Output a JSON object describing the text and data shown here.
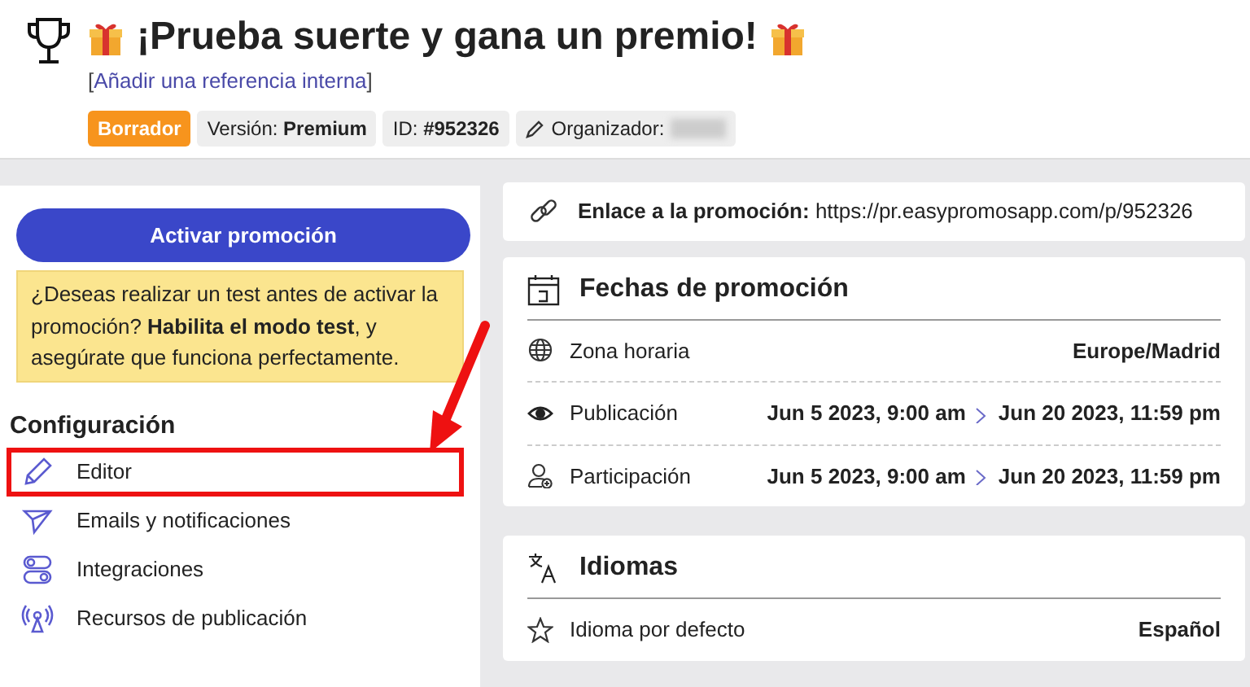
{
  "header": {
    "title": "¡Prueba suerte y gana un premio!",
    "reference_open": "[",
    "reference_link": "Añadir una referencia interna",
    "reference_close": "]",
    "badges": [
      {
        "kind": "status",
        "text": "Borrador"
      },
      {
        "kind": "field",
        "label": "Versión:",
        "value": "Premium"
      },
      {
        "kind": "field",
        "label": "ID:",
        "value": "#952326"
      },
      {
        "kind": "organizer",
        "label": "Organizador:"
      }
    ]
  },
  "sidebar": {
    "activate_button": "Activar promoción",
    "notice": {
      "before": "¿Deseas realizar un test antes de activar la promoción?",
      "link": "Habilita el modo test",
      "after": ", y asegúrate que funciona perfectamente."
    },
    "section_title": "Configuración",
    "items": [
      {
        "kind": "pencil",
        "label": "Editor",
        "highlighted": true
      },
      {
        "kind": "send",
        "label": "Emails y notificaciones",
        "highlighted": false
      },
      {
        "kind": "toggles",
        "label": "Integraciones",
        "highlighted": false
      },
      {
        "kind": "antenna",
        "label": "Recursos de publicación",
        "highlighted": false
      }
    ]
  },
  "link_card": {
    "label": "Enlace a la promoción:",
    "url": "https://pr.easypromosapp.com/p/952326"
  },
  "dates_card": {
    "title": "Fechas de promoción",
    "rows": [
      {
        "kind": "globe",
        "label": "Zona horaria",
        "value": "Europe/Madrid"
      },
      {
        "kind": "eye",
        "label": "Publicación",
        "start": "Jun 5 2023, 9:00 am",
        "end": "Jun 20 2023, 11:59 pm"
      },
      {
        "kind": "user",
        "label": "Participación",
        "start": "Jun 5 2023, 9:00 am",
        "end": "Jun 20 2023, 11:59 pm"
      }
    ]
  },
  "languages_card": {
    "title": "Idiomas",
    "rows": [
      {
        "kind": "star",
        "label": "Idioma por defecto",
        "value": "Español"
      }
    ]
  }
}
